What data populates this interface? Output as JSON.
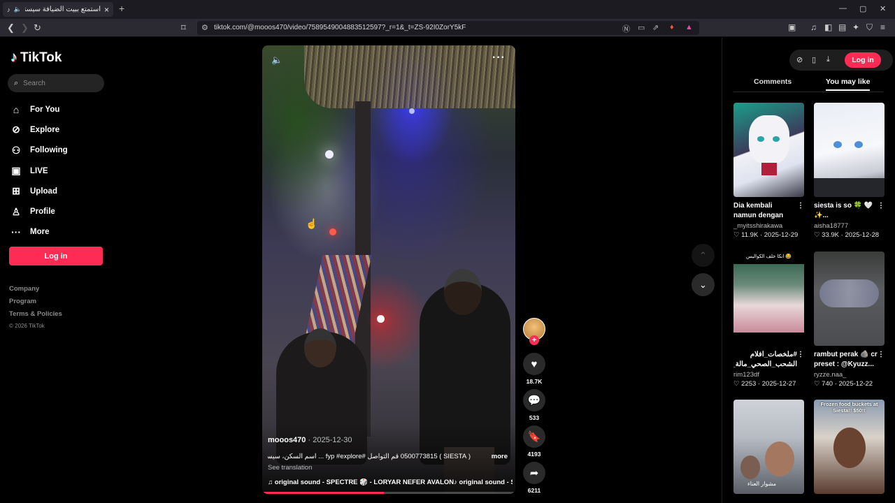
{
  "browser": {
    "tab_title": "استمتع ببيت الضيافة سيستا ب",
    "tab_close": "×",
    "new_tab": "+",
    "url": "tiktok.com/@mooos470/video/7589549004883512597?_r=1&_t=ZS-92I0ZorY5kF",
    "win_min": "—",
    "win_max": "▢",
    "win_close": "✕"
  },
  "sidebar": {
    "logo": "TikTok",
    "search_placeholder": "Search",
    "nav": [
      {
        "label": "For You",
        "icon": "home-icon"
      },
      {
        "label": "Explore",
        "icon": "compass-icon"
      },
      {
        "label": "Following",
        "icon": "following-icon"
      },
      {
        "label": "LIVE",
        "icon": "live-icon"
      },
      {
        "label": "Upload",
        "icon": "upload-icon"
      },
      {
        "label": "Profile",
        "icon": "profile-icon"
      },
      {
        "label": "More",
        "icon": "more-icon"
      }
    ],
    "login": "Log in",
    "footer": {
      "company": "Company",
      "program": "Program",
      "terms": "Terms & Policies",
      "copyright": "© 2026 TikTok"
    }
  },
  "video": {
    "author": "mooos470",
    "date": "2025-12-30",
    "caption": "( SIESTA ) 0500773815 قم التواصل #fyp #explore ... اسم السكن، سيستا",
    "more": "more",
    "see_translation": "See translation",
    "sound": "original sound - SPECTRE 🎲 - LORYAR NEFER AVALON♪ original sound - SPECT",
    "progress": 0.48
  },
  "actions": {
    "likes": "18.7K",
    "comments": "533",
    "saves": "4193",
    "shares": "6211"
  },
  "right_panel": {
    "login": "Log in",
    "tabs": [
      "Comments",
      "You may like"
    ],
    "active_tab": "You may like",
    "cards": [
      {
        "title": "Dia kembali namun dengan tubuh...",
        "user": "_myitsshirakawa",
        "likes": "11.9K",
        "date": "2025-12-29"
      },
      {
        "title": "siesta is so 🍀 🤍 ✨...",
        "user": "aisha18777",
        "likes": "33.9K",
        "date": "2025-12-28"
      },
      {
        "title": "#ملخصات_افلام الشحب_الصحي_مالة_حل...",
        "user": "rim123df",
        "likes": "2253",
        "date": "2025-12-27"
      },
      {
        "title": "rambut perak 🪨 cr preset : @Kyuzz...",
        "user": "ryzze.naa_",
        "likes": "740",
        "date": "2025-12-22"
      },
      {
        "title": "",
        "user": "",
        "likes": "",
        "date": ""
      },
      {
        "title": "",
        "user": "",
        "likes": "",
        "date": ""
      }
    ],
    "card3_overlay": "انكا خلف الكواليس 😂",
    "card6_overlay": "Frozen food buckets at Siesta!! $50!!",
    "card5_overlay": "مشوار العناء"
  }
}
